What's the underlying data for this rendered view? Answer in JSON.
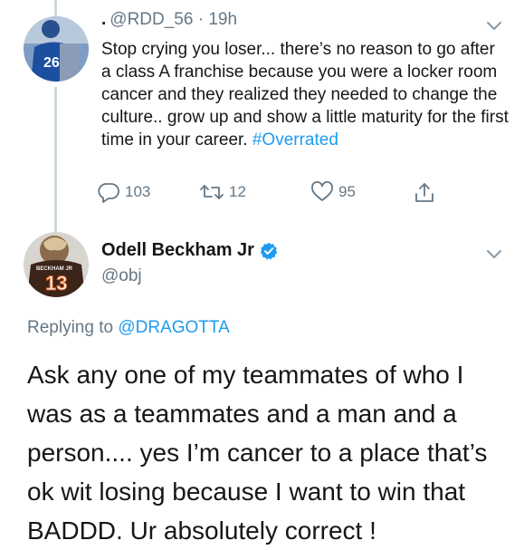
{
  "tweet1": {
    "dot": ".",
    "handle": "@RDD_56",
    "separator": " · ",
    "time": "19h",
    "text": "Stop crying you loser... there’s no reason to go after a class A franchise because you were a locker room cancer and they realized they needed to change the culture.. grow up and show a little maturity for the first time in your career. ",
    "hashtag": "#Overrated",
    "avatar_jersey_number": "26",
    "actions": {
      "replies": "103",
      "retweets": "12",
      "likes": "95"
    }
  },
  "tweet2": {
    "display_name": "Odell Beckham Jr",
    "handle": "@obj",
    "replying_prefix": "Replying to ",
    "replying_to": "@DRAGOTTA",
    "text": "Ask any one of my teammates of who I was as a teammates and a man and a person.... yes I’m cancer to a place that’s ok wit losing because I want to win that BADDD. Ur absolutely correct !",
    "avatar_jersey_name": "BECKHAM JR",
    "avatar_jersey_number": "13"
  },
  "colors": {
    "accent": "#1d9bf0",
    "muted": "#657786",
    "thread_line": "#cfd9de",
    "giants_blue": "#1c4fa0",
    "browns_brown": "#3b2418"
  },
  "icons": [
    "chevron-down-icon",
    "reply-icon",
    "retweet-icon",
    "like-icon",
    "share-icon",
    "verified-badge-icon"
  ]
}
